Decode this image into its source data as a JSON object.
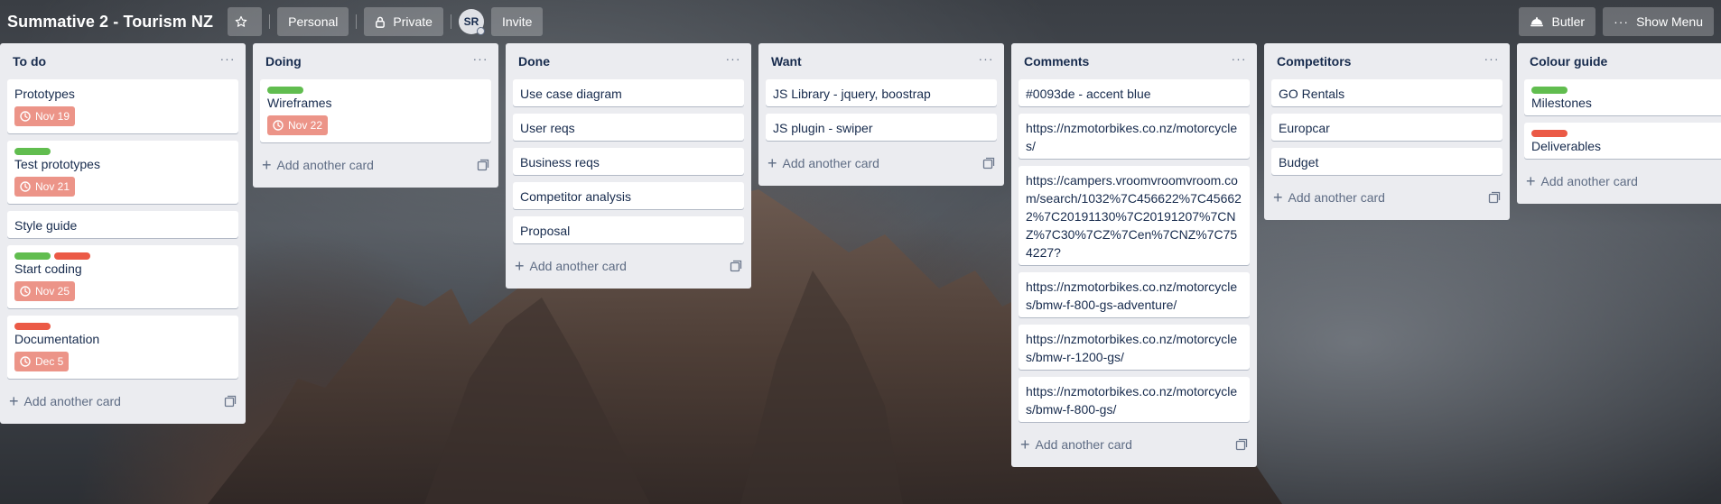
{
  "header": {
    "board_title": "Summative 2 - Tourism NZ",
    "personal_label": "Personal",
    "private_label": "Private",
    "avatar_initials": "SR",
    "invite_label": "Invite",
    "butler_label": "Butler",
    "show_menu_label": "Show Menu"
  },
  "add_card_label": "Add another card",
  "colors": {
    "green": "#61bd4f",
    "red": "#eb5a46",
    "due_badge": "#ec9488"
  },
  "lists": [
    {
      "title": "To do",
      "cards": [
        {
          "title": "Prototypes",
          "labels": [],
          "due": "Nov 19"
        },
        {
          "title": "Test prototypes",
          "labels": [
            "green"
          ],
          "due": "Nov 21"
        },
        {
          "title": "Style guide",
          "labels": [],
          "due": null
        },
        {
          "title": "Start coding",
          "labels": [
            "green",
            "red"
          ],
          "due": "Nov 25"
        },
        {
          "title": "Documentation",
          "labels": [
            "red"
          ],
          "due": "Dec 5"
        }
      ]
    },
    {
      "title": "Doing",
      "cards": [
        {
          "title": "Wireframes",
          "labels": [
            "green"
          ],
          "due": "Nov 22"
        }
      ]
    },
    {
      "title": "Done",
      "cards": [
        {
          "title": "Use case diagram",
          "labels": [],
          "due": null
        },
        {
          "title": "User reqs",
          "labels": [],
          "due": null
        },
        {
          "title": "Business reqs",
          "labels": [],
          "due": null
        },
        {
          "title": "Competitor analysis",
          "labels": [],
          "due": null
        },
        {
          "title": "Proposal",
          "labels": [],
          "due": null
        }
      ]
    },
    {
      "title": "Want",
      "cards": [
        {
          "title": "JS Library - jquery, boostrap",
          "labels": [],
          "due": null
        },
        {
          "title": "JS plugin - swiper",
          "labels": [],
          "due": null
        }
      ]
    },
    {
      "title": "Comments",
      "cards": [
        {
          "title": "#0093de - accent blue",
          "labels": [],
          "due": null
        },
        {
          "title": "https://nzmotorbikes.co.nz/motorcycles/",
          "labels": [],
          "due": null
        },
        {
          "title": "https://campers.vroomvroomvroom.com/search/1032%7C456622%7C456622%7C20191130%7C20191207%7CNZ%7C30%7CZ%7Cen%7CNZ%7C754227?",
          "labels": [],
          "due": null
        },
        {
          "title": "https://nzmotorbikes.co.nz/motorcycles/bmw-f-800-gs-adventure/",
          "labels": [],
          "due": null
        },
        {
          "title": "https://nzmotorbikes.co.nz/motorcycles/bmw-r-1200-gs/",
          "labels": [],
          "due": null
        },
        {
          "title": "https://nzmotorbikes.co.nz/motorcycles/bmw-f-800-gs/",
          "labels": [],
          "due": null
        }
      ]
    },
    {
      "title": "Competitors",
      "cards": [
        {
          "title": "GO Rentals",
          "labels": [],
          "due": null
        },
        {
          "title": "Europcar",
          "labels": [],
          "due": null
        },
        {
          "title": "Budget",
          "labels": [],
          "due": null
        }
      ]
    },
    {
      "title": "Colour guide",
      "cards": [
        {
          "title": "Milestones",
          "labels": [
            "green"
          ],
          "due": null
        },
        {
          "title": "Deliverables",
          "labels": [
            "red"
          ],
          "due": null
        }
      ]
    }
  ]
}
